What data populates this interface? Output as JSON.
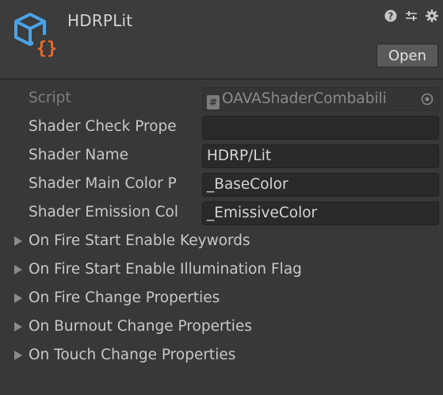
{
  "header": {
    "title": "HDRPLit",
    "open_label": "Open",
    "icons": [
      "help-icon",
      "preset-sliders-icon",
      "gear-icon"
    ],
    "asset_icon": "shader-graph-icon"
  },
  "fields": [
    {
      "label": "Script",
      "value": "OAVAShaderCombabili",
      "disabled": true
    },
    {
      "label": "Shader Check Prope",
      "value": ""
    },
    {
      "label": "Shader Name",
      "value": "HDRP/Lit"
    },
    {
      "label": "Shader Main Color P",
      "value": "_BaseColor"
    },
    {
      "label": "Shader Emission Col",
      "value": "_EmissiveColor"
    }
  ],
  "foldouts": [
    "On Fire Start Enable Keywords",
    "On Fire Start Enable Illumination Flag",
    "On Fire Change Properties",
    "On Burnout Change Properties",
    "On Touch Change Properties"
  ],
  "colors": {
    "background": "#383838",
    "header": "#3c3c3c",
    "field": "#2a2a2a",
    "icon_blue": "#4aa3e8",
    "icon_orange": "#f06a2a"
  }
}
